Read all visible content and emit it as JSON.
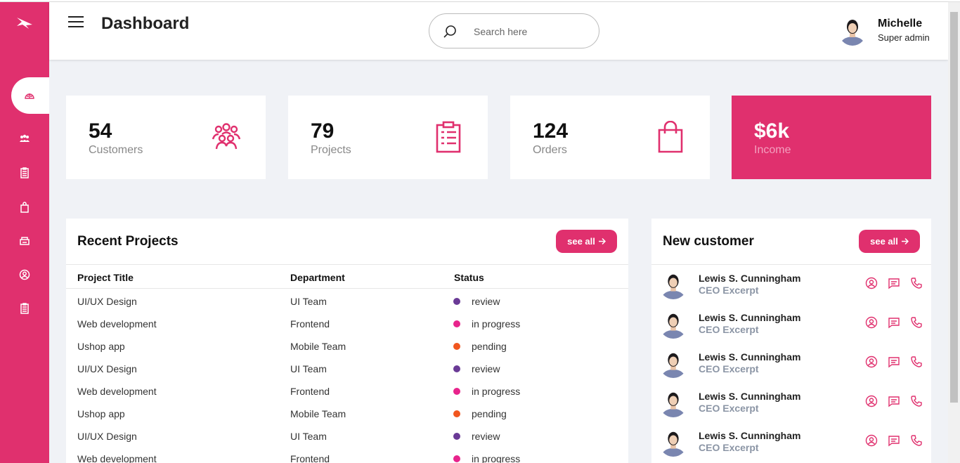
{
  "header": {
    "title": "Dashboard",
    "search_placeholder": "Search here",
    "user": {
      "name": "Michelle",
      "role": "Super admin"
    }
  },
  "sidebar": {
    "items": [
      {
        "icon": "dashboard-icon",
        "active": true
      },
      {
        "icon": "customers-icon"
      },
      {
        "icon": "projects-icon"
      },
      {
        "icon": "orders-icon"
      },
      {
        "icon": "inventory-icon"
      },
      {
        "icon": "account-icon"
      },
      {
        "icon": "tasks-icon"
      }
    ]
  },
  "cards": [
    {
      "value": "54",
      "label": "Customers",
      "icon": "users-icon"
    },
    {
      "value": "79",
      "label": "Projects",
      "icon": "clipboard-icon"
    },
    {
      "value": "124",
      "label": "Orders",
      "icon": "shopping-bag-icon"
    },
    {
      "value": "$6k",
      "label": "Income",
      "icon": ""
    }
  ],
  "recent_projects": {
    "title": "Recent Projects",
    "see_all": "see all",
    "columns": [
      "Project Title",
      "Department",
      "Status"
    ],
    "rows": [
      {
        "title": "UI/UX Design",
        "department": "UI Team",
        "status": "review",
        "status_color": "#6a3a96"
      },
      {
        "title": "Web development",
        "department": "Frontend",
        "status": "in progress",
        "status_color": "#e8248c"
      },
      {
        "title": "Ushop app",
        "department": "Mobile Team",
        "status": "pending",
        "status_color": "#f1561f"
      },
      {
        "title": "UI/UX Design",
        "department": "UI Team",
        "status": "review",
        "status_color": "#6a3a96"
      },
      {
        "title": "Web development",
        "department": "Frontend",
        "status": "in progress",
        "status_color": "#e8248c"
      },
      {
        "title": "Ushop app",
        "department": "Mobile Team",
        "status": "pending",
        "status_color": "#f1561f"
      },
      {
        "title": "UI/UX Design",
        "department": "UI Team",
        "status": "review",
        "status_color": "#6a3a96"
      },
      {
        "title": "Web development",
        "department": "Frontend",
        "status": "in progress",
        "status_color": "#e8248c"
      }
    ]
  },
  "new_customer": {
    "title": "New customer",
    "see_all": "see all",
    "customers": [
      {
        "name": "Lewis S. Cunningham",
        "role": "CEO Excerpt"
      },
      {
        "name": "Lewis S. Cunningham",
        "role": "CEO Excerpt"
      },
      {
        "name": "Lewis S. Cunningham",
        "role": "CEO Excerpt"
      },
      {
        "name": "Lewis S. Cunningham",
        "role": "CEO Excerpt"
      },
      {
        "name": "Lewis S. Cunningham",
        "role": "CEO Excerpt"
      }
    ]
  },
  "colors": {
    "accent": "#e0306e",
    "background": "#f0f2f6",
    "muted": "#8b95a5"
  }
}
